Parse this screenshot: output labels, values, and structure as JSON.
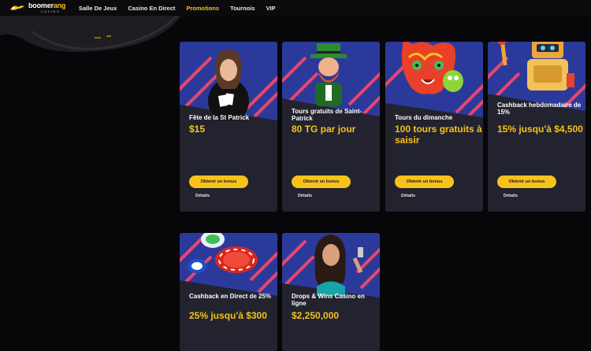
{
  "brand": {
    "name_main": "boomer",
    "name_accent": "ang",
    "tagline": "CASINO",
    "brand_color": "#f7c21b"
  },
  "nav": {
    "items": [
      {
        "label": "Salle De Jeux"
      },
      {
        "label": "Casino En Direct"
      },
      {
        "label": "Promotions",
        "active": true
      },
      {
        "label": "Tournois"
      },
      {
        "label": "VIP"
      }
    ]
  },
  "cards": [
    {
      "title": "Fête de la St Patrick",
      "offer": "$15",
      "button": "Obtenir un bonus",
      "details": "Détails",
      "image_icon": "dealer-woman-cards"
    },
    {
      "title": "Tours gratuits de Saint-Patrick",
      "offer": "80 TG par jour",
      "button": "Obtenir un bonus",
      "details": "Détails",
      "image_icon": "leprechaun"
    },
    {
      "title": "Tours du dimanche",
      "offer": "100 tours gratuits à saisir",
      "button": "Obtenir un bonus",
      "details": "Détails",
      "image_icon": "tiger-mask"
    },
    {
      "title": "Cashback hebdomadaire de 15%",
      "offer": "15% jusqu'à $4,500",
      "button": "Obtenir un bonus",
      "details": "Détails",
      "image_icon": "robot-trophy"
    },
    {
      "title": "Cashback en Direct de 25%",
      "offer": "25% jusqu'à $300",
      "image_icon": "casino-chips"
    },
    {
      "title": "Drops & Wins Casino en ligne",
      "offer": "$2,250,000",
      "image_icon": "woman-phone"
    }
  ]
}
